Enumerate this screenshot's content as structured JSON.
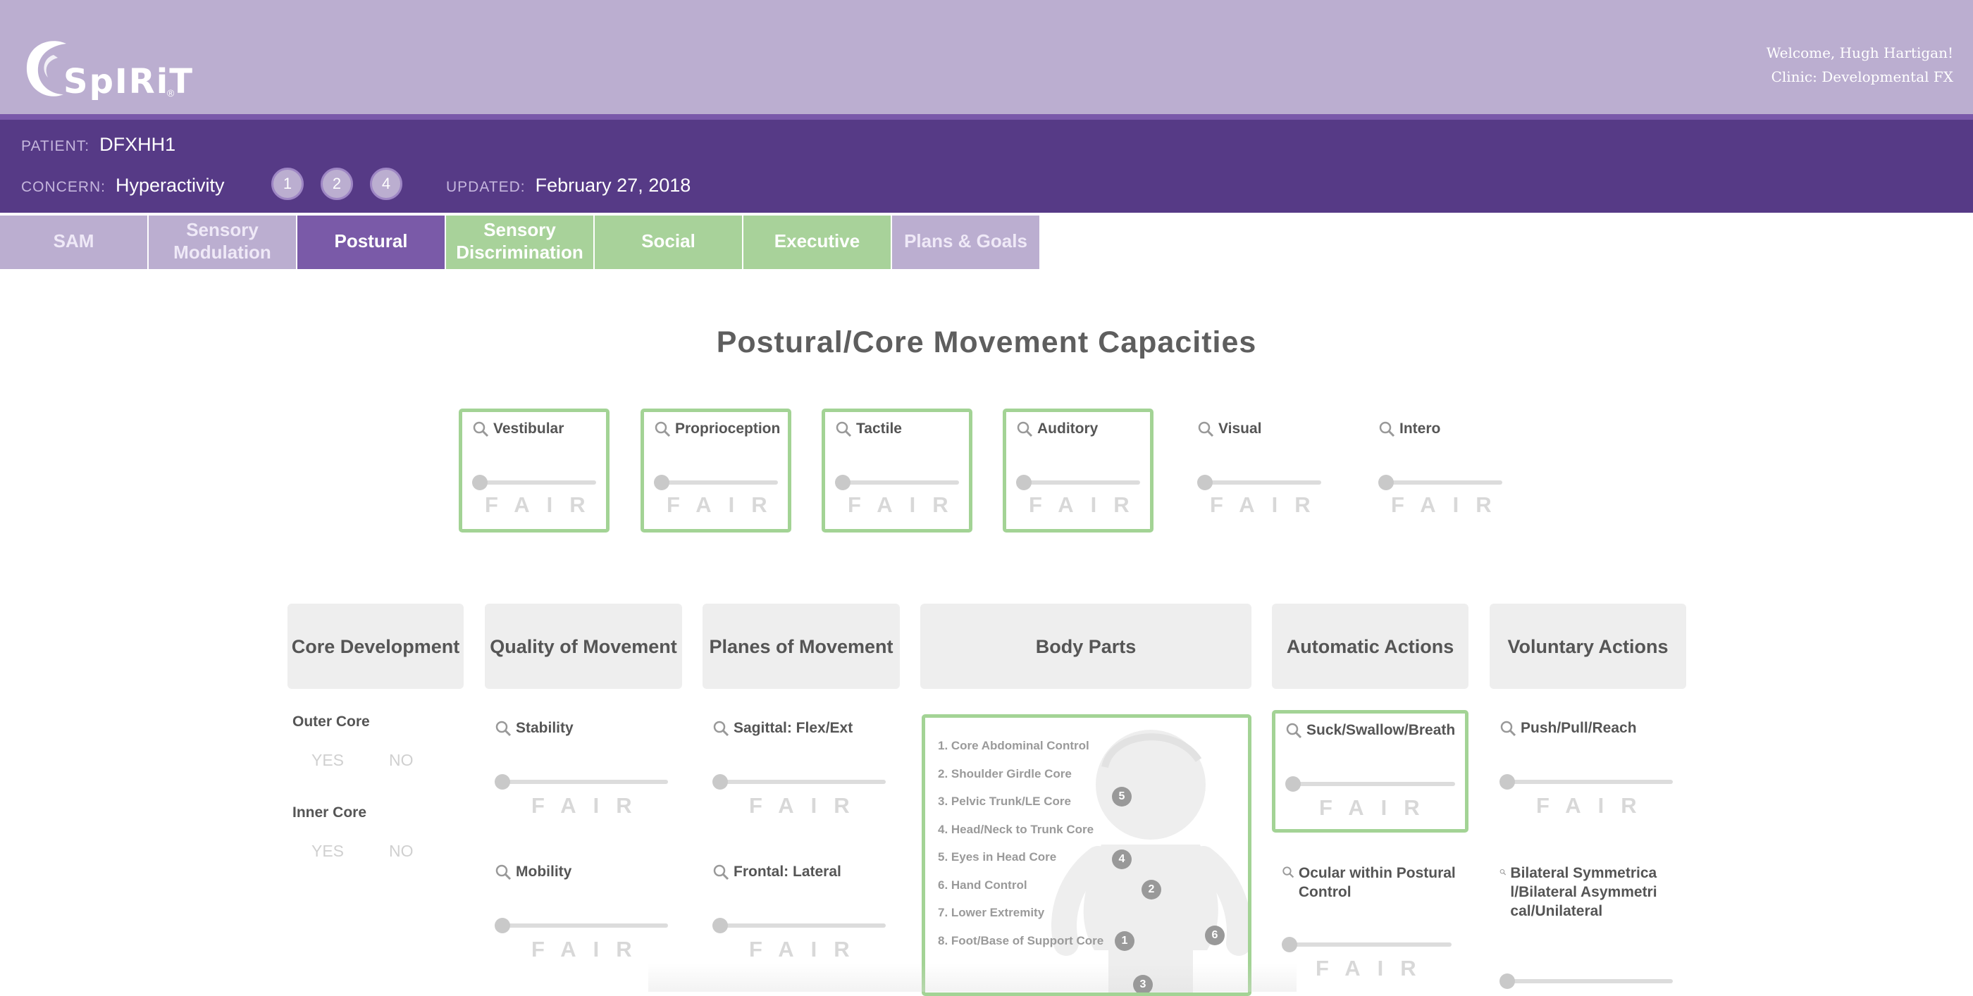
{
  "app": {
    "logo_text": "SpIRiT",
    "logo_mark": "®",
    "welcome": "Welcome, Hugh Hartigan!",
    "clinic": "Clinic: Developmental FX"
  },
  "patient": {
    "patient_label": "PATIENT:",
    "patient_id": "DFXHH1",
    "concern_label": "CONCERN:",
    "concern": "Hyperactivity",
    "badges": [
      "1",
      "2",
      "4"
    ],
    "updated_label": "UPDATED:",
    "updated": "February 27, 2018"
  },
  "tabs": [
    {
      "label": "SAM",
      "style": "purple"
    },
    {
      "label": "Sensory Modulation",
      "style": "purple"
    },
    {
      "label": "Postural",
      "style": "active"
    },
    {
      "label": "Sensory Discrimination",
      "style": "green"
    },
    {
      "label": "Social",
      "style": "green"
    },
    {
      "label": "Executive",
      "style": "green"
    },
    {
      "label": "Plans & Goals",
      "style": "purple"
    }
  ],
  "page_title": "Postural/Core Movement Capacities",
  "rating_label": "FAIR",
  "sensory": [
    {
      "label": "Vestibular",
      "highlighted": true,
      "level": 0
    },
    {
      "label": "Proprioception",
      "highlighted": true,
      "level": 0
    },
    {
      "label": "Tactile",
      "highlighted": true,
      "level": 0
    },
    {
      "label": "Auditory",
      "highlighted": true,
      "level": 0
    },
    {
      "label": "Visual",
      "highlighted": false,
      "level": 0
    },
    {
      "label": "Intero",
      "highlighted": false,
      "level": 0
    }
  ],
  "columns": {
    "core_development": "Core Development",
    "quality_of_movement": "Quality of Movement",
    "planes_of_movement": "Planes of Movement",
    "body_parts": "Body Parts",
    "automatic_actions": "Automatic Actions",
    "voluntary_actions": "Voluntary Actions"
  },
  "core": {
    "outer_core": "Outer Core",
    "inner_core": "Inner Core",
    "yes": "YES",
    "no": "NO"
  },
  "quality_items": [
    "Stability",
    "Mobility"
  ],
  "planes_items": [
    "Sagittal: Flex/Ext",
    "Frontal: Lateral"
  ],
  "body_parts_list": [
    "1. Core Abdominal Control",
    "2. Shoulder Girdle Core",
    "3. Pelvic Trunk/LE Core",
    "4. Head/Neck to Trunk Core",
    "5. Eyes in Head Core",
    "6. Hand Control",
    "7. Lower Extremity",
    "8. Foot/Base of Support Core"
  ],
  "body_markers": [
    "5",
    "4",
    "2",
    "1",
    "6",
    "3"
  ],
  "automatic_items": [
    "Suck/Swallow/Breath",
    "Ocular within Postural Control"
  ],
  "voluntary_items": [
    "Push/Pull/Reach",
    "Bilateral Symmetrical/Bilateral Asymmetrical/Unilateral"
  ],
  "colors": {
    "header_light": "#bbaed0",
    "header_dark": "#563a86",
    "tab_active": "#7a5aa8",
    "tab_green": "#a8d29a",
    "highlight_border": "#a3d395"
  }
}
